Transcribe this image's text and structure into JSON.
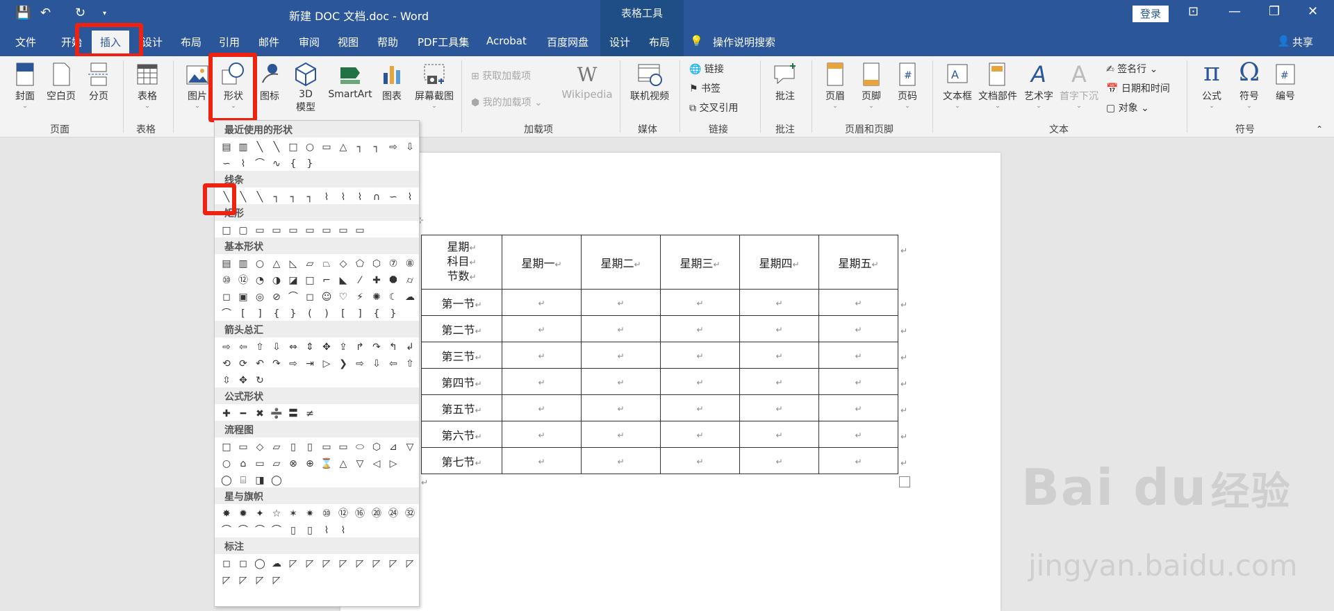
{
  "titlebar": {
    "title": "新建 DOC 文档.doc  -  Word",
    "context_title": "表格工具",
    "login": "登录",
    "save_icon": "save-icon",
    "undo_icon": "undo-icon",
    "redo_icon": "redo-icon"
  },
  "tabs": [
    "文件",
    "开始",
    "插入",
    "设计",
    "布局",
    "引用",
    "邮件",
    "审阅",
    "视图",
    "帮助",
    "PDF工具集",
    "Acrobat",
    "百度网盘",
    "设计",
    "布局"
  ],
  "tell_me": "操作说明搜索",
  "share": "共享",
  "ribbon": {
    "cover": "封面",
    "blank": "空白页",
    "pagebreak": "分页",
    "group_page": "页面",
    "table": "表格",
    "group_table": "表格",
    "picture": "图片",
    "shapes": "形状",
    "icons": "图标",
    "model3d_1": "3D",
    "model3d_2": "模型",
    "smartart": "SmartArt",
    "chart": "图表",
    "screenshot": "屏幕截图",
    "get_addins": "获取加载项",
    "my_addins": "我的加载项",
    "wikipedia": "Wikipedia",
    "group_addins": "加载项",
    "online_video": "联机视频",
    "group_media": "媒体",
    "link": "链接",
    "bookmark": "书签",
    "crossref": "交叉引用",
    "group_links": "链接",
    "comment": "批注",
    "group_comments": "批注",
    "header": "页眉",
    "footer": "页脚",
    "pagenum": "页码",
    "group_hf": "页眉和页脚",
    "textbox": "文本框",
    "docparts": "文档部件",
    "wordart": "艺术字",
    "dropcap": "首字下沉",
    "signature": "签名行",
    "datetime": "日期和时间",
    "object": "对象",
    "group_text": "文本",
    "equation": "公式",
    "symbol": "符号",
    "number": "编号",
    "group_symbols": "符号"
  },
  "shapes_panel": {
    "sections": [
      {
        "title": "最近使用的形状",
        "rows": [
          "▤▥╲╲□○▭△┐┐⇨⇩",
          "∽⌇⌒∿{}"
        ]
      },
      {
        "title": "线条",
        "rows": [
          "╲╲╲┐┐┐⌇⌇⌇∩∽⌇"
        ]
      },
      {
        "title": "矩形",
        "rows": [
          "□▢▭▭▭▭▭▭▭"
        ]
      },
      {
        "title": "基本形状",
        "rows": [
          "▤▥○△◺▱⏢◇⬠⬡⑦⑧",
          "⑩⑫◔◑◪□⌐◣⁄✚⯃⌭",
          "◻▣◎⊘⌒◻☺♡⚡✺☾☁",
          "⌒[]{}()[]{}"
        ]
      },
      {
        "title": "箭头总汇",
        "rows": [
          "⇨⇦⇧⇩⇔⇕✥⇪↱↷↰↲",
          "⟲⟳↶↷⇨⇥▷❯⇨⇩⇦⇧",
          "⇳✥↻"
        ]
      },
      {
        "title": "公式形状",
        "rows": [
          "✚━✖➗〓≠"
        ]
      },
      {
        "title": "流程图",
        "rows": [
          "□▭◇▱▯▯▭▭⬭⬡⊿▽",
          "○⌂▭▱⊗⊕⌛△▽◁▷",
          "◯⌸◨◯"
        ]
      },
      {
        "title": "星与旗帜",
        "rows": [
          "✸✹✦☆✶✷⑩⑫⑯⑳㉔㉜",
          "⌒⌒⌒⌒▯▯⌇⌇"
        ]
      },
      {
        "title": "标注",
        "rows": [
          "◻◻◯☁◸◸◸◸◸◸◸◸",
          "◸◸◸◸"
        ]
      }
    ]
  },
  "doc_table": {
    "header": {
      "line1": "星期",
      "line2": "科目",
      "line3": "节数",
      "days": [
        "星期一",
        "星期二",
        "星期三",
        "星期四",
        "星期五"
      ]
    },
    "rows": [
      "第一节",
      "第二节",
      "第三节",
      "第四节",
      "第五节",
      "第六节",
      "第七节"
    ],
    "return_mark": "↵"
  },
  "watermark": {
    "brand": "Bai du",
    "cn": "经验",
    "url": "jingyan.baidu.com"
  },
  "colors": {
    "accent": "#2b579a",
    "highlight": "#e21"
  }
}
